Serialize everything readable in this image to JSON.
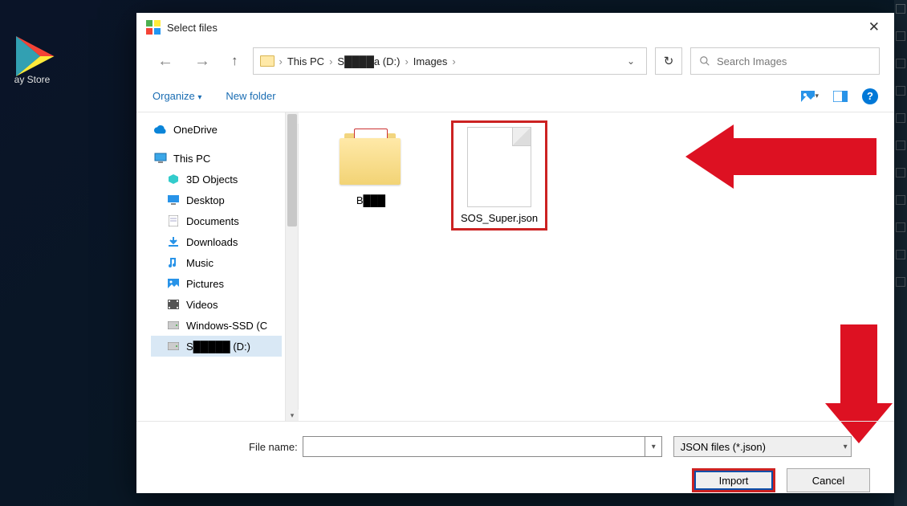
{
  "background": {
    "playstore_label": "ay Store"
  },
  "dialog": {
    "title": "Select files",
    "breadcrumbs": [
      "This PC",
      "S████a (D:)",
      "Images"
    ],
    "search_placeholder": "Search Images",
    "toolbar": {
      "organize": "Organize",
      "new_folder": "New folder"
    },
    "navpane": {
      "onedrive": "OneDrive",
      "thispc": "This PC",
      "items": [
        "3D Objects",
        "Desktop",
        "Documents",
        "Downloads",
        "Music",
        "Pictures",
        "Videos",
        "Windows-SSD (C",
        "S█████ (D:)"
      ]
    },
    "files": {
      "folder_name": "B███",
      "json_name": "SOS_Super.json"
    },
    "footer": {
      "filename_label": "File name:",
      "filename_value": "",
      "filter_label": "JSON files (*.json)",
      "import": "Import",
      "cancel": "Cancel"
    }
  }
}
